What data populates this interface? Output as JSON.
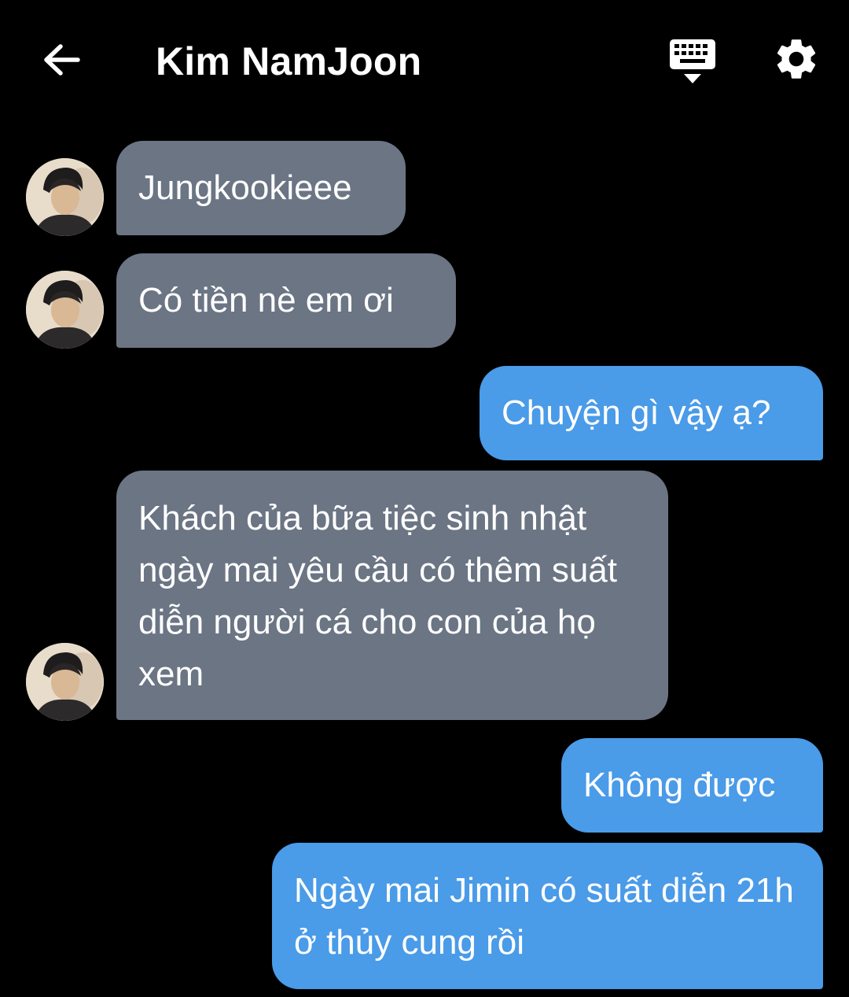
{
  "header": {
    "title": "Kim NamJoon",
    "back_icon": "arrow-left-icon",
    "keyboard_icon": "keyboard-icon",
    "settings_icon": "gear-icon"
  },
  "colors": {
    "background": "#000000",
    "incoming_bubble": "#6b7584",
    "outgoing_bubble": "#4a9be8",
    "text": "#ffffff"
  },
  "messages": [
    {
      "sender": "Kim NamJoon",
      "direction": "incoming",
      "text": "Jungkookieee"
    },
    {
      "sender": "Kim NamJoon",
      "direction": "incoming",
      "text": "Có tiền nè em ơi"
    },
    {
      "sender": "me",
      "direction": "outgoing",
      "text": "Chuyện gì vậy ạ?"
    },
    {
      "sender": "Kim NamJoon",
      "direction": "incoming",
      "text": "Khách của bữa tiệc sinh nhật ngày mai yêu cầu có thêm suất diễn người cá cho con của họ xem"
    },
    {
      "sender": "me",
      "direction": "outgoing",
      "text": "Không được"
    },
    {
      "sender": "me",
      "direction": "outgoing",
      "text": "Ngày mai Jimin có suất diễn 21h ở thủy cung rồi"
    }
  ]
}
